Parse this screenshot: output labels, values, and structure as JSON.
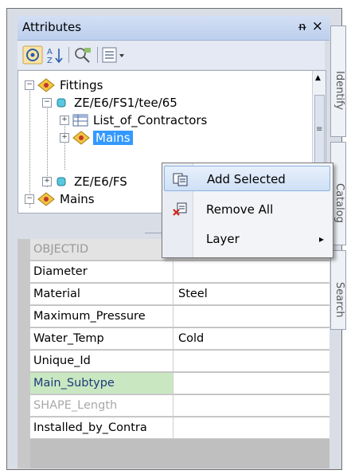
{
  "window": {
    "title": "Attributes",
    "pin": "ᵰ",
    "close": "×"
  },
  "side_tabs": [
    "Identify",
    "Catalog",
    "Search"
  ],
  "tree": {
    "nodes": [
      {
        "label": "Fittings",
        "expander": "−"
      },
      {
        "label": "ZE/E6/FS1/tee/65",
        "expander": "−"
      },
      {
        "label": "List_of_Contractors",
        "expander": "+"
      },
      {
        "label": "Mains",
        "expander": "+"
      },
      {
        "label": "ZE/E6/FS",
        "expander": "+"
      },
      {
        "label": "Mains",
        "expander": "−"
      }
    ]
  },
  "context_menu": {
    "items": [
      {
        "label": "Add Selected",
        "icon": "add-selected-icon"
      },
      {
        "label": "Remove All",
        "icon": "remove-all-icon"
      },
      {
        "label": "Layer",
        "icon": "",
        "submenu": "▸"
      }
    ]
  },
  "grid": {
    "rows": [
      {
        "name": "OBJECTID",
        "value": ""
      },
      {
        "name": "Diameter",
        "value": ""
      },
      {
        "name": "Material",
        "value": "Steel"
      },
      {
        "name": "Maximum_Pressure",
        "value": ""
      },
      {
        "name": "Water_Temp",
        "value": "Cold"
      },
      {
        "name": "Unique_Id",
        "value": ""
      },
      {
        "name": "Main_Subtype",
        "value": ""
      },
      {
        "name": "SHAPE_Length",
        "value": ""
      },
      {
        "name": "Installed_by_Contra",
        "value": ""
      }
    ]
  },
  "colors": {
    "selection": "#3399ff",
    "highlight_row": "#c9e8c1",
    "menu_hover": "#cfe0f6"
  }
}
